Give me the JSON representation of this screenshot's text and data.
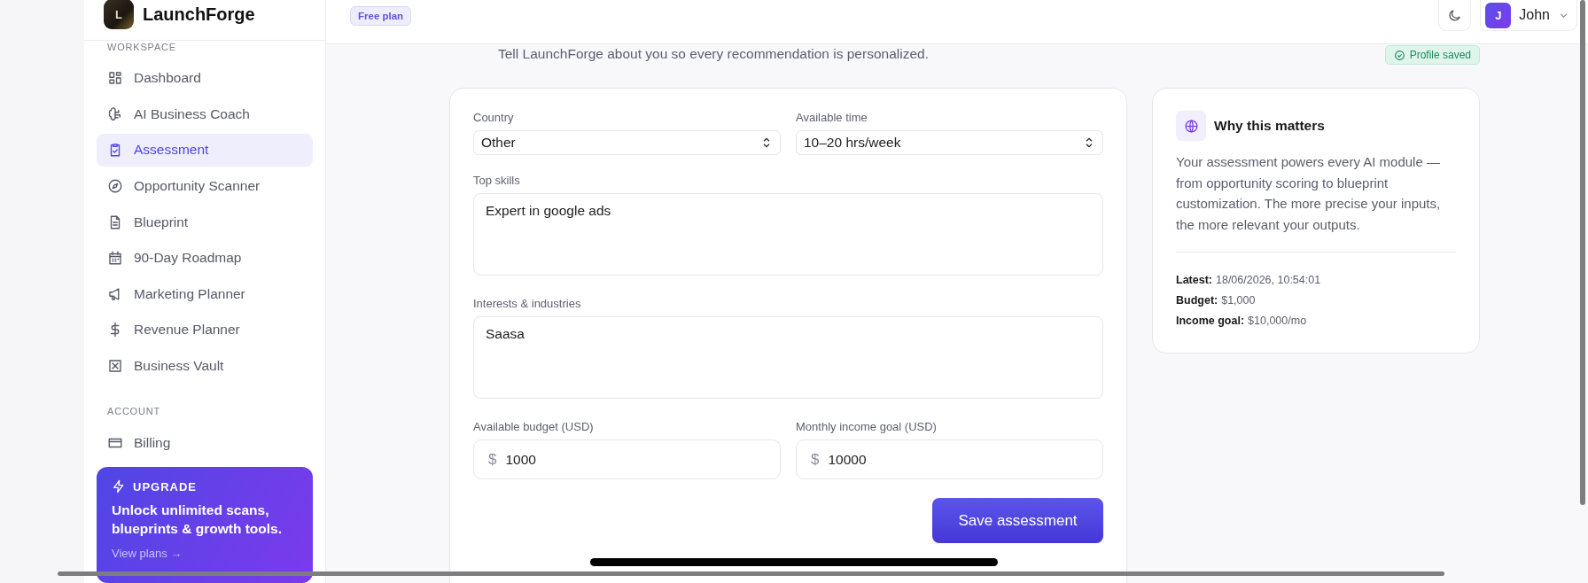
{
  "sidebar": {
    "brand": "LaunchForge",
    "logo_letter": "L",
    "sections": [
      {
        "heading": "WORKSPACE",
        "items": [
          {
            "label": "Dashboard",
            "selected": false
          },
          {
            "label": "AI Business Coach",
            "selected": false
          },
          {
            "label": "Assessment",
            "selected": true
          },
          {
            "label": "Opportunity Scanner",
            "selected": false
          },
          {
            "label": "Blueprint",
            "selected": false
          },
          {
            "label": "90-Day Roadmap",
            "selected": false
          },
          {
            "label": "Marketing Planner",
            "selected": false
          },
          {
            "label": "Revenue Planner",
            "selected": false
          },
          {
            "label": "Business Vault",
            "selected": false
          }
        ]
      },
      {
        "heading": "ACCOUNT",
        "items": [
          {
            "label": "Billing",
            "selected": false
          }
        ]
      }
    ],
    "upgrade": {
      "title": "UPGRADE",
      "text": "Unlock unlimited scans, blueprints & growth tools.",
      "link": "View plans →"
    }
  },
  "header": {
    "plan_badge": "Free plan",
    "user": {
      "initial": "J",
      "name": "John"
    }
  },
  "page": {
    "subtitle": "Tell LaunchForge about you so every recommendation is personalized.",
    "status": "Profile saved"
  },
  "form": {
    "fields": [
      {
        "kind": "select",
        "label": "Country",
        "value": "Other"
      },
      {
        "kind": "select",
        "label": "Available time",
        "value": "10–20 hrs/week"
      },
      {
        "kind": "textarea",
        "label": "Top skills",
        "value": "Expert in google ads"
      },
      {
        "kind": "textarea",
        "label": "Interests & industries",
        "value": "Saasa"
      },
      {
        "kind": "currency",
        "label": "Available budget (USD)",
        "prefix": "$",
        "value": "1000"
      },
      {
        "kind": "currency",
        "label": "Monthly income goal (USD)",
        "prefix": "$",
        "value": "10000"
      }
    ],
    "submit": "Save assessment"
  },
  "info": {
    "title": "Why this matters",
    "text": "Your assessment powers every AI module — from opportunity scoring to blueprint customization. The more precise your inputs, the more relevant your outputs.",
    "details": [
      {
        "label": "Latest:",
        "value": "18/06/2026, 10:54:01"
      },
      {
        "label": "Budget:",
        "value": "$1,000"
      },
      {
        "label": "Income goal:",
        "value": "$10,000/mo"
      }
    ]
  }
}
